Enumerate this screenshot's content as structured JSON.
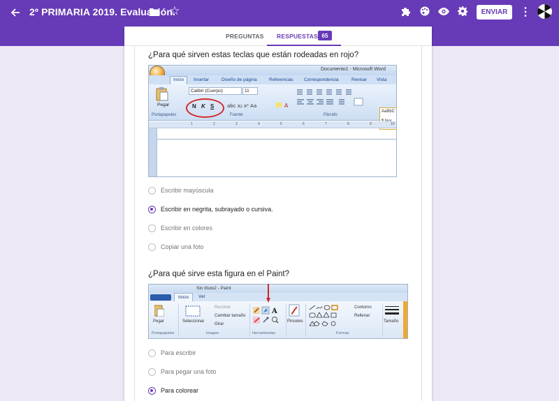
{
  "header": {
    "title": "2º PRIMARIA 2019. Evaluación.",
    "send_label": "ENVIAR",
    "icons": [
      "arrow-back-icon",
      "folder-icon",
      "star-outline-icon",
      "puzzle-icon",
      "palette-icon",
      "eye-icon",
      "gear-icon",
      "more-vert-icon"
    ],
    "accent": "#673ab7"
  },
  "tabs": {
    "questions": "PREGUNTAS",
    "responses": "RESPUESTAS",
    "responses_count": "65"
  },
  "questions": [
    {
      "text": "¿Para qué sirven estas teclas que están rodeadas en rojo?",
      "image": {
        "app": "Microsoft Word",
        "window_title": "Documento1 - Microsoft Word",
        "ribbon_tabs": [
          "Inicio",
          "Insertar",
          "Diseño de página",
          "Referencias",
          "Correspondencia",
          "Revisar",
          "Vista"
        ],
        "font_name": "Calibri (Cuerpo)",
        "font_size": "11",
        "format_buttons": [
          "N",
          "K",
          "S"
        ],
        "groups": [
          "Portapapeles",
          "Fuente",
          "Párrafo"
        ],
        "paste_label": "Pegar",
        "style_preview": "AaBbC",
        "style_name": "¶ Nor",
        "ruler_numbers": [
          "1",
          "2",
          "3",
          "4",
          "5",
          "6",
          "7",
          "8",
          "9",
          "10"
        ]
      },
      "options": [
        {
          "label": "Escribir mayúscula",
          "selected": false
        },
        {
          "label": "Escribir en negrita, subrayado o cursiva.",
          "selected": true
        },
        {
          "label": "Escribir en colores",
          "selected": false
        },
        {
          "label": "Copiar una foto",
          "selected": false
        }
      ]
    },
    {
      "text": "¿Para qué sirve esta figura en el Paint?",
      "image": {
        "app": "Paint",
        "window_title": "Sin título2 - Paint",
        "ribbon_tabs": [
          "Inicio",
          "Ver"
        ],
        "labels": {
          "pegar": "Pegar",
          "seleccionar": "Seleccionar",
          "recortar": "Recortar",
          "cambiar_tamano": "Cambiar tamaño",
          "girar": "Girar",
          "pinceles": "Pinceles",
          "contorno": "Contorno",
          "rellenar": "Rellenar",
          "tamano": "Tamaño"
        },
        "groups": [
          "Portapapeles",
          "Imagen",
          "Herramientas",
          "Formas"
        ]
      },
      "options": [
        {
          "label": "Para escribir",
          "selected": false
        },
        {
          "label": "Para pegar una foto",
          "selected": false
        },
        {
          "label": "Para colorear",
          "selected": true
        }
      ]
    }
  ]
}
